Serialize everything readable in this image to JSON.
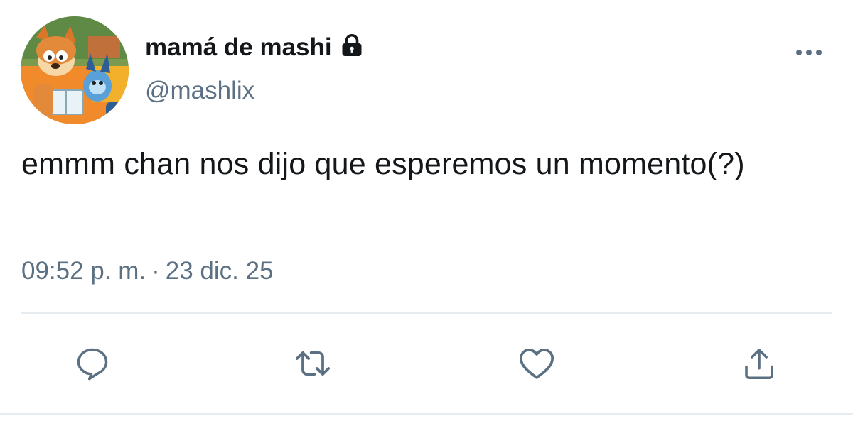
{
  "tweet": {
    "display_name": "mamá de mashi",
    "handle": "@mashlix",
    "text": "emmm chan nos dijo que esperemos un momento(?)",
    "time": "09:52 p. m.",
    "separator": "·",
    "date": "23 dic. 25",
    "protected": true
  },
  "icons": {
    "lock": "lock-icon",
    "more": "more-icon",
    "reply": "reply-icon",
    "retweet": "retweet-icon",
    "like": "heart-icon",
    "share": "share-icon"
  },
  "colors": {
    "text": "#14171a",
    "secondary": "#5b7083",
    "divider": "#e6ecf0"
  }
}
